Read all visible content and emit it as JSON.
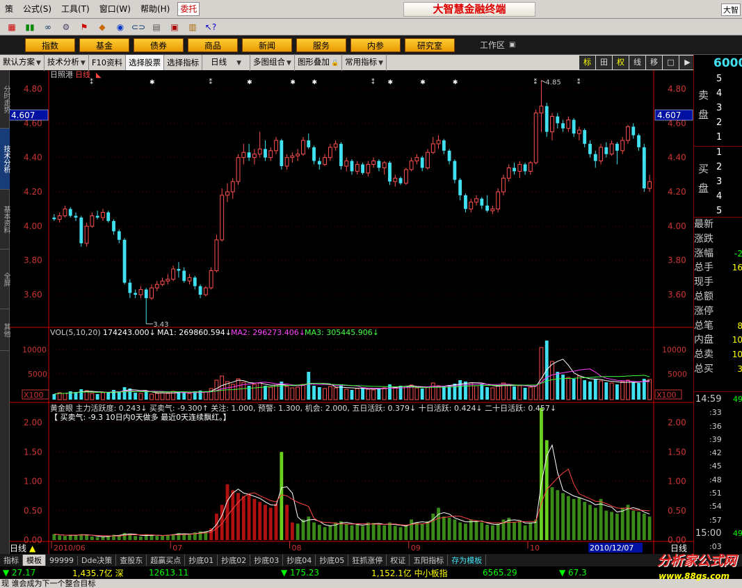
{
  "menu": [
    "策(",
    "公式(",
    "工具(",
    "窗口(",
    "帮助("
  ],
  "menu_keys": [
    "",
    "公式(S)",
    "工具(T)",
    "窗口(W)",
    "帮助(H)"
  ],
  "menu_labels": [
    "策",
    "公式(S)",
    "工具(T)",
    "窗口(W)",
    "帮助(H)"
  ],
  "weituo": "委托",
  "app_title": "大智慧金融终端",
  "corner": "大智",
  "nav_buttons": [
    "指数",
    "基金",
    "债券",
    "商品",
    "新闻",
    "服务",
    "内参",
    "研究室"
  ],
  "workspace": "工作区",
  "tabs": [
    "默认方案",
    "技术分析",
    "F10资料",
    "选择股票",
    "选择指标",
    "日线",
    "多图组合",
    "图形叠加",
    "常用指标"
  ],
  "right_tools": [
    "标",
    "田",
    "权",
    "线",
    "移",
    "□",
    "▶"
  ],
  "left_tabs": [
    "分时走势",
    "技术分析",
    "基本资料",
    "全屏",
    "其他"
  ],
  "stock": {
    "name": "日照港",
    "period": "日线"
  },
  "price_label": "4.607",
  "price_ticks": [
    "4.80",
    "4.60",
    "4.40",
    "4.20",
    "4.00",
    "3.80",
    "3.60"
  ],
  "price_high": "4.85",
  "price_low": "3.43",
  "vol_line": {
    "vol": "VOL(5,10,20)",
    "v": "174243.000↓",
    "ma1": "MA1: 269860.594↓",
    "ma2": "MA2: 296273.406↓",
    "ma3": "MA3: 305445.906↓"
  },
  "vol_ticks": [
    "10000",
    "5000"
  ],
  "vol_unit": "X100",
  "ind_line1": "黄金眼  主力活跃度: 0.243↓ 买卖气: -9.300↑ 关注: 1.000, 预警: 1.300, 机会: 2.000, 五日活跃: 0.379↓ 十日活跃: 0.424↓ 二十日活跃: 0.457↓",
  "ind_line2": "【  买卖气: -9.3      10日内0天做多     最近0天连续飘红。】",
  "ind_ticks": [
    "2.00",
    "1.50",
    "1.00",
    "0.50",
    "0.00"
  ],
  "x_labels": [
    "2010/06",
    "07",
    "08",
    "09",
    "10"
  ],
  "date_box": "2010/12/07",
  "day_label": "日线",
  "right": {
    "price": "6000",
    "sell": [
      "5",
      "4",
      "3",
      "2",
      "1"
    ],
    "buy": [
      "1",
      "2",
      "3",
      "4",
      "5"
    ],
    "sell_label": "卖盘",
    "buy_label": "买盘",
    "fields": [
      "最新",
      "涨跌",
      "涨幅",
      "总手",
      "现手",
      "总额",
      "涨停",
      "总笔",
      "内盘",
      "总卖",
      "总买"
    ],
    "field_vals": [
      "",
      "",
      "-2",
      "16",
      "",
      "",
      "",
      "8",
      "10",
      "10",
      "3"
    ],
    "times": [
      "14:59",
      ":33",
      ":36",
      ":39",
      ":42",
      ":45",
      ":48",
      ":51",
      ":54",
      ":57",
      "15:00",
      ":03"
    ],
    "time_vals": [
      "49",
      "",
      "",
      "",
      "",
      "",
      "",
      "",
      "",
      "",
      "49",
      ""
    ]
  },
  "bottom_tabs": [
    "指标",
    "模板",
    "99999",
    "Dde决策",
    "查股东",
    "超赢买点",
    "抄底01",
    "抄底02",
    "抄底03",
    "抄底04",
    "抄底05",
    "狂抓涨停",
    "权证",
    "五阳指标",
    "存为模板"
  ],
  "status": [
    {
      "t": "▼ 27.17",
      "c": "#0f0"
    },
    {
      "t": "1,435.7亿 深",
      "c": "#ff0"
    },
    {
      "t": "12613.11",
      "c": "#0f0"
    },
    {
      "t": "▼ 175.23",
      "c": "#0f0"
    },
    {
      "t": "1,152.1亿 中小板指",
      "c": "#ff0"
    },
    {
      "t": "6565.29",
      "c": "#0f0"
    },
    {
      "t": "▼ 67.3",
      "c": "#0f0"
    }
  ],
  "message": "现 谁会成为下一个整合目标",
  "logo": "分析家公式网",
  "logo_url": "www.88gs.com",
  "colors": {
    "up": "#ff5050",
    "down": "#40e0f0",
    "ma1": "#ffffff",
    "ma2": "#ff40ff",
    "ma3": "#40ff40"
  },
  "chart_data": {
    "type": "candlestick",
    "candles": [
      [
        4.05,
        4.07,
        4.03,
        4.04
      ],
      [
        4.04,
        4.08,
        4.02,
        4.06
      ],
      [
        4.06,
        4.12,
        4.05,
        4.1
      ],
      [
        4.1,
        4.11,
        4.05,
        4.06
      ],
      [
        4.06,
        4.08,
        4.03,
        4.05
      ],
      [
        4.05,
        4.06,
        3.88,
        3.9
      ],
      [
        3.9,
        4.02,
        3.88,
        4.0
      ],
      [
        4.0,
        4.08,
        3.99,
        4.06
      ],
      [
        4.06,
        4.09,
        4.04,
        4.05
      ],
      [
        4.05,
        4.1,
        4.03,
        4.08
      ],
      [
        4.08,
        4.09,
        4.02,
        4.03
      ],
      [
        4.03,
        4.04,
        3.95,
        3.97
      ],
      [
        3.97,
        3.98,
        3.9,
        3.92
      ],
      [
        3.92,
        3.93,
        3.66,
        3.67
      ],
      [
        3.67,
        3.69,
        3.58,
        3.61
      ],
      [
        3.61,
        3.63,
        3.58,
        3.6
      ],
      [
        3.6,
        3.65,
        3.58,
        3.63
      ],
      [
        3.63,
        3.64,
        3.43,
        3.58
      ],
      [
        3.58,
        3.66,
        3.57,
        3.64
      ],
      [
        3.64,
        3.68,
        3.62,
        3.66
      ],
      [
        3.66,
        3.7,
        3.65,
        3.68
      ],
      [
        3.68,
        3.72,
        3.66,
        3.69
      ],
      [
        3.69,
        3.77,
        3.68,
        3.75
      ],
      [
        3.75,
        3.79,
        3.7,
        3.74
      ],
      [
        3.74,
        3.76,
        3.67,
        3.68
      ],
      [
        3.68,
        3.72,
        3.66,
        3.7
      ],
      [
        3.7,
        3.71,
        3.63,
        3.65
      ],
      [
        3.65,
        3.66,
        3.58,
        3.6
      ],
      [
        3.6,
        3.65,
        3.59,
        3.64
      ],
      [
        3.64,
        3.76,
        3.63,
        3.74
      ],
      [
        3.74,
        3.95,
        3.73,
        3.92
      ],
      [
        3.92,
        4.22,
        3.91,
        4.18
      ],
      [
        4.18,
        4.25,
        4.14,
        4.2
      ],
      [
        4.2,
        4.28,
        4.16,
        4.26
      ],
      [
        4.26,
        4.42,
        4.24,
        4.4
      ],
      [
        4.4,
        4.48,
        4.36,
        4.43
      ],
      [
        4.43,
        4.48,
        4.38,
        4.4
      ],
      [
        4.4,
        4.45,
        4.36,
        4.42
      ],
      [
        4.42,
        4.55,
        4.4,
        4.45
      ],
      [
        4.45,
        4.5,
        4.38,
        4.4
      ],
      [
        4.4,
        4.46,
        4.38,
        4.44
      ],
      [
        4.44,
        4.52,
        4.42,
        4.5
      ],
      [
        4.5,
        4.51,
        4.33,
        4.35
      ],
      [
        4.35,
        4.42,
        4.33,
        4.4
      ],
      [
        4.4,
        4.43,
        4.37,
        4.41
      ],
      [
        4.41,
        4.45,
        4.38,
        4.42
      ],
      [
        4.42,
        4.52,
        4.41,
        4.5
      ],
      [
        4.5,
        4.54,
        4.45,
        4.46
      ],
      [
        4.46,
        4.47,
        4.36,
        4.38
      ],
      [
        4.38,
        4.4,
        4.33,
        4.36
      ],
      [
        4.36,
        4.42,
        4.35,
        4.4
      ],
      [
        4.4,
        4.48,
        4.38,
        4.46
      ],
      [
        4.46,
        4.5,
        4.44,
        4.48
      ],
      [
        4.48,
        4.49,
        4.33,
        4.35
      ],
      [
        4.35,
        4.4,
        4.32,
        4.38
      ],
      [
        4.38,
        4.39,
        4.3,
        4.32
      ],
      [
        4.32,
        4.38,
        4.3,
        4.36
      ],
      [
        4.36,
        4.37,
        4.3,
        4.31
      ],
      [
        4.31,
        4.38,
        4.29,
        4.36
      ],
      [
        4.36,
        4.4,
        4.34,
        4.38
      ],
      [
        4.38,
        4.39,
        4.32,
        4.34
      ],
      [
        4.34,
        4.38,
        4.3,
        4.37
      ],
      [
        4.37,
        4.38,
        4.24,
        4.26
      ],
      [
        4.26,
        4.3,
        4.23,
        4.28
      ],
      [
        4.28,
        4.29,
        4.24,
        4.25
      ],
      [
        4.25,
        4.34,
        4.24,
        4.33
      ],
      [
        4.33,
        4.4,
        4.32,
        4.38
      ],
      [
        4.38,
        4.42,
        4.36,
        4.4
      ],
      [
        4.4,
        4.41,
        4.32,
        4.34
      ],
      [
        4.34,
        4.45,
        4.33,
        4.43
      ],
      [
        4.43,
        4.52,
        4.42,
        4.48
      ],
      [
        4.48,
        4.53,
        4.45,
        4.5
      ],
      [
        4.5,
        4.51,
        4.42,
        4.44
      ],
      [
        4.44,
        4.45,
        4.36,
        4.38
      ],
      [
        4.38,
        4.39,
        4.25,
        4.27
      ],
      [
        4.27,
        4.28,
        4.15,
        4.18
      ],
      [
        4.18,
        4.19,
        4.08,
        4.1
      ],
      [
        4.1,
        4.16,
        4.08,
        4.14
      ],
      [
        4.14,
        4.18,
        4.12,
        4.16
      ],
      [
        4.16,
        4.17,
        4.1,
        4.12
      ],
      [
        4.12,
        4.18,
        4.08,
        4.09
      ],
      [
        4.09,
        4.12,
        4.07,
        4.1
      ],
      [
        4.1,
        4.22,
        4.08,
        4.2
      ],
      [
        4.2,
        4.3,
        4.18,
        4.28
      ],
      [
        4.28,
        4.36,
        4.26,
        4.34
      ],
      [
        4.34,
        4.37,
        4.3,
        4.32
      ],
      [
        4.32,
        4.38,
        4.28,
        4.36
      ],
      [
        4.36,
        4.37,
        4.3,
        4.32
      ],
      [
        4.32,
        4.38,
        4.3,
        4.37
      ],
      [
        4.37,
        4.68,
        4.36,
        4.66
      ],
      [
        4.66,
        4.85,
        4.55,
        4.7
      ],
      [
        4.7,
        4.72,
        4.52,
        4.55
      ],
      [
        4.55,
        4.66,
        4.5,
        4.64
      ],
      [
        4.64,
        4.66,
        4.57,
        4.6
      ],
      [
        4.6,
        4.62,
        4.55,
        4.57
      ],
      [
        4.57,
        4.64,
        4.55,
        4.62
      ],
      [
        4.62,
        4.63,
        4.52,
        4.54
      ],
      [
        4.54,
        4.58,
        4.5,
        4.56
      ],
      [
        4.56,
        4.57,
        4.46,
        4.48
      ],
      [
        4.48,
        4.5,
        4.4,
        4.42
      ],
      [
        4.42,
        4.44,
        4.34,
        4.38
      ],
      [
        4.38,
        4.48,
        4.36,
        4.46
      ],
      [
        4.46,
        4.49,
        4.4,
        4.42
      ],
      [
        4.42,
        4.5,
        4.41,
        4.48
      ],
      [
        4.48,
        4.49,
        4.36,
        4.44
      ],
      [
        4.44,
        4.52,
        4.42,
        4.5
      ],
      [
        4.5,
        4.59,
        4.48,
        4.58
      ],
      [
        4.58,
        4.6,
        4.51,
        4.53
      ],
      [
        4.53,
        4.54,
        4.44,
        4.46
      ],
      [
        4.46,
        4.48,
        4.2,
        4.22
      ],
      [
        4.22,
        4.3,
        4.2,
        4.26
      ]
    ],
    "volume": [
      8,
      10,
      9,
      12,
      11,
      15,
      13,
      9,
      8,
      10,
      11,
      14,
      12,
      18,
      16,
      10,
      9,
      13,
      8,
      9,
      10,
      9,
      12,
      11,
      10,
      9,
      12,
      13,
      11,
      16,
      28,
      34,
      26,
      22,
      30,
      25,
      20,
      22,
      24,
      20,
      18,
      21,
      26,
      19,
      17,
      18,
      22,
      40,
      20,
      18,
      16,
      19,
      17,
      20,
      15,
      14,
      16,
      17,
      15,
      14,
      16,
      17,
      22,
      18,
      20,
      19,
      21,
      17,
      16,
      18,
      24,
      20,
      19,
      21,
      23,
      28,
      26,
      24,
      20,
      22,
      18,
      17,
      20,
      24,
      22,
      19,
      20,
      17,
      18,
      21,
      75,
      85,
      55,
      40,
      36,
      32,
      30,
      34,
      28,
      26,
      30,
      27,
      25,
      24,
      22,
      26,
      28,
      25,
      24,
      30,
      29
    ],
    "activity": [
      0.1,
      0.08,
      0.07,
      0.09,
      0.08,
      0.1,
      0.09,
      0.06,
      0.05,
      0.06,
      0.07,
      0.09,
      0.08,
      0.12,
      0.11,
      0.07,
      0.06,
      0.1,
      0.08,
      0.07,
      0.08,
      0.09,
      0.1,
      0.12,
      0.1,
      0.09,
      0.13,
      0.15,
      0.14,
      0.2,
      0.45,
      0.6,
      0.95,
      0.85,
      0.8,
      0.75,
      0.78,
      0.7,
      0.65,
      0.6,
      0.55,
      0.62,
      1.5,
      0.6,
      0.3,
      0.28,
      0.35,
      0.4,
      0.3,
      0.26,
      0.22,
      0.25,
      0.3,
      0.32,
      0.28,
      0.25,
      0.27,
      0.24,
      0.3,
      0.29,
      0.26,
      0.25,
      0.3,
      0.24,
      0.22,
      0.25,
      0.35,
      0.3,
      0.28,
      0.32,
      0.45,
      0.55,
      0.4,
      0.38,
      0.35,
      0.3,
      0.28,
      0.35,
      0.32,
      0.3,
      0.26,
      0.25,
      0.28,
      0.35,
      0.38,
      0.3,
      0.32,
      0.25,
      0.3,
      0.35,
      2.25,
      1.7,
      0.9,
      0.85,
      0.8,
      0.75,
      0.7,
      0.72,
      0.65,
      0.6,
      0.55,
      0.7,
      0.5,
      0.48,
      0.45,
      0.55,
      0.6,
      0.5,
      0.48,
      0.45,
      0.4
    ],
    "activity_red_range": [
      29,
      44
    ],
    "ylim_price": [
      3.43,
      4.9
    ],
    "ylim_activity": [
      0,
      2.3
    ]
  }
}
